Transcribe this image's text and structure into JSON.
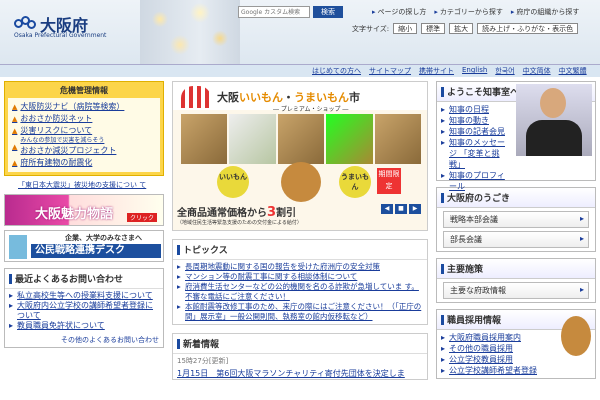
{
  "header": {
    "site_title": "大阪府",
    "site_subtitle": "Osaka Prefectural Government",
    "search_placeholder": "Google カスタム検索",
    "search_button": "検索",
    "toplinks": [
      "ページの探し方",
      "カテゴリーから探す",
      "府庁の組織から探す"
    ],
    "font_size_label": "文字サイズ:",
    "font_sizes": [
      "縮小",
      "標準",
      "拡大"
    ],
    "read_aloud": "読み上げ・ふりがな・表示色"
  },
  "nav": [
    "はじめての方へ",
    "サイトマップ",
    "携帯サイト",
    "English",
    "한국어",
    "中文简体",
    "中文繁體"
  ],
  "crisis": {
    "title": "危機管理情報",
    "items": [
      "大阪防災ナビ（病院等検索）",
      "おおさか防災ネット",
      "災害リスクについて",
      "おおさか減災プロジェクト",
      "府所有建物の耐震化"
    ],
    "small_note": "みんなの参加で災害を減らそう",
    "link": "「東日本大震災」被災地の支援につい て"
  },
  "banners": {
    "charm": "大阪魅力物語",
    "charm_click": "クリック",
    "partner_top": "企業、大学のみなさまへ",
    "partner": "公民戦略連携デスク"
  },
  "faq": {
    "title": "最近よくあるお問い合わせ",
    "items": [
      "私立高校生等への授業料支援について",
      "大阪府内公立学校の講師希望者登録に ついて",
      "教員職員免許状について"
    ],
    "more": "その他のよくあるお問い合わせ"
  },
  "promo": {
    "title_a": "大阪",
    "title_b": "いいもん",
    "title_c": "・",
    "title_d": "うまいもん",
    "title_e": "市",
    "subtitle": "― プレミアム・ショップ ―",
    "badge_left": "いいもん",
    "badge_right": "うまいもん",
    "limited": "期間限定",
    "sale": "全商品通常価格から",
    "sale_num": "3",
    "sale_suffix": "割引",
    "note": "（地域住民生活等緊急支援のための交付金による給付）"
  },
  "topics": {
    "title": "トピックス",
    "items": [
      "長周期地震動に関する国の報告を受けた府洲庁の安全対策",
      "マンション等の耐震工事に関する相談体制について",
      "府消費生活センターなどの公的機関を名のる詐欺が急増していま す。不審な電話にご注意ください！",
      "本館耐震等改修工事のため、来庁の際にはご注意ください！（「正庁の間」展示室」一般公開則間、執務室の館内仮移転など）"
    ]
  },
  "news": {
    "title": "新着情報",
    "updated": "15時27分[更新]",
    "row": "1月15日　第6回大阪マラソンチャリティ寄付先団体を決定しま"
  },
  "governor": {
    "title": "ようこそ知事室へ",
    "items": [
      "知事の日程",
      "知事の動き",
      "知事の記者会見",
      "知事のメッセージ 「変革と挑戦」",
      "知事のプロフィール"
    ]
  },
  "trends": {
    "title": "大阪府のうごき",
    "items": [
      "戦略本部会議",
      "部長会議"
    ]
  },
  "policy": {
    "title": "主要施策",
    "items": [
      "主要な府政情報"
    ]
  },
  "jobs": {
    "title": "職員採用情報",
    "items": [
      "大阪府職員採用案内",
      "その他の職員採用",
      "公立学校教員採用",
      "公立学校講師希望者登録"
    ]
  },
  "promo_controls": [
    "◀",
    "■",
    "▶"
  ]
}
